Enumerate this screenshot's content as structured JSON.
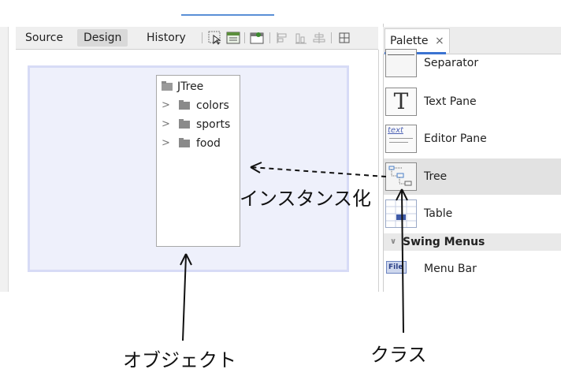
{
  "editor": {
    "tabs": [
      {
        "label": "Source"
      },
      {
        "label": "Design"
      },
      {
        "label": "History"
      }
    ],
    "active_tab": "Design",
    "toolbar_icons": [
      "select-mode-icon",
      "connection-mode-icon",
      "preview-design-icon",
      "align-left-icon",
      "align-right-icon",
      "align-center-icon",
      "grid-icon"
    ]
  },
  "jtree": {
    "root": "JTree",
    "nodes": [
      "colors",
      "sports",
      "food"
    ]
  },
  "palette": {
    "tab_label": "Palette",
    "close_glyph": "×",
    "items": [
      {
        "label": "Separator",
        "icon": "separator-icon"
      },
      {
        "label": "Text Pane",
        "icon": "text-pane-icon",
        "glyph": "T"
      },
      {
        "label": "Editor Pane",
        "icon": "editor-pane-icon",
        "glyph": "text"
      },
      {
        "label": "Tree",
        "icon": "tree-icon",
        "selected": true
      },
      {
        "label": "Table",
        "icon": "table-icon"
      }
    ],
    "section": {
      "label": "Swing Menus",
      "icon": "chevron-down-icon"
    },
    "section_items": [
      {
        "label": "Menu Bar",
        "icon": "menu-bar-icon",
        "glyph": "File"
      }
    ]
  },
  "annotations": {
    "instantiate": "インスタンス化",
    "object": "オブジェクト",
    "class": "クラス"
  },
  "colors": {
    "accent": "#3b73d1",
    "design_surface": "#eef0fb",
    "design_border": "#d7dbf6"
  }
}
